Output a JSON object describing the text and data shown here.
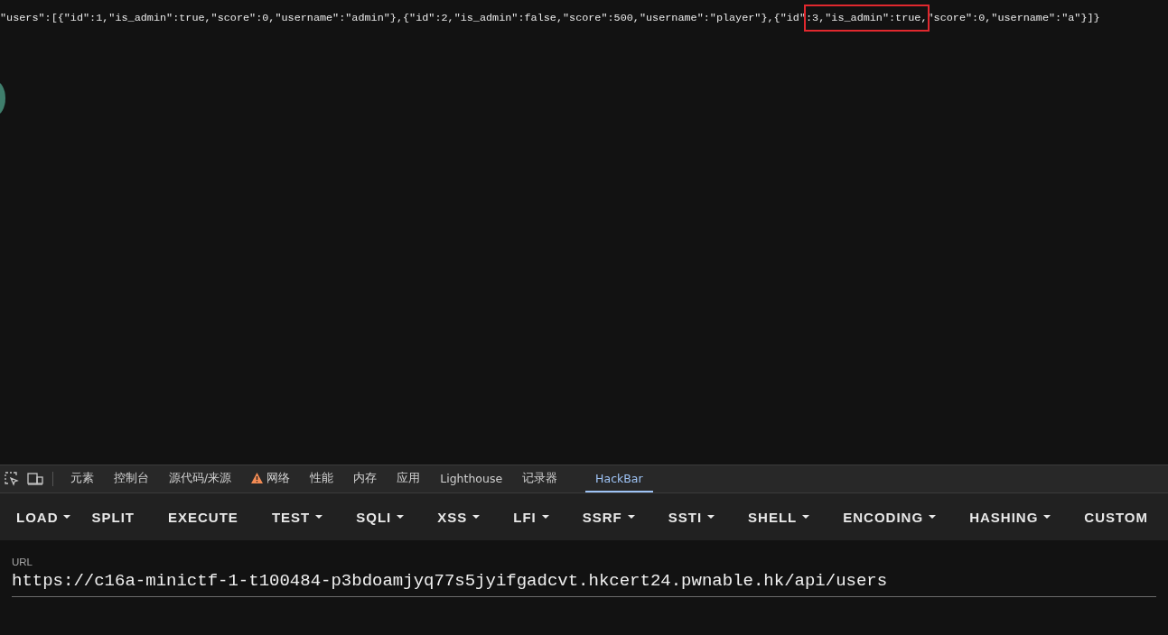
{
  "response": {
    "segments": [
      {
        "text": "\"users\":[{\"id\":1,\"is_admin\":true,\"score\":0,\"username\":\"admin\"},{\"id\":2,\"is_admin\":false,\"score\":500,\"username\":\"player\"},{\"id\"",
        "highlighted": false
      },
      {
        "text": ":3,\"is_admin\":true,",
        "highlighted": true
      },
      {
        "text": "\"score\":0,\"username\":\"a\"}]}",
        "highlighted": false
      }
    ]
  },
  "devtools": {
    "tabs": [
      {
        "label": "元素",
        "selected": false,
        "warning": false
      },
      {
        "label": "控制台",
        "selected": false,
        "warning": false
      },
      {
        "label": "源代码/来源",
        "selected": false,
        "warning": false
      },
      {
        "label": "网络",
        "selected": false,
        "warning": true
      },
      {
        "label": "性能",
        "selected": false,
        "warning": false
      },
      {
        "label": "内存",
        "selected": false,
        "warning": false
      },
      {
        "label": "应用",
        "selected": false,
        "warning": false
      },
      {
        "label": "Lighthouse",
        "selected": false,
        "warning": false
      },
      {
        "label": "记录器",
        "selected": false,
        "warning": false
      },
      {
        "label": "HackBar",
        "selected": true,
        "warning": false
      }
    ]
  },
  "hackbar": {
    "buttons": [
      {
        "label": "LOAD",
        "kind": "split"
      },
      {
        "label": "SPLIT",
        "kind": "plain"
      },
      {
        "label": "EXECUTE",
        "kind": "plain"
      },
      {
        "label": "TEST",
        "kind": "menu"
      },
      {
        "label": "SQLI",
        "kind": "menu"
      },
      {
        "label": "XSS",
        "kind": "menu"
      },
      {
        "label": "LFI",
        "kind": "menu"
      },
      {
        "label": "SSRF",
        "kind": "menu"
      },
      {
        "label": "SSTI",
        "kind": "menu"
      },
      {
        "label": "SHELL",
        "kind": "menu"
      },
      {
        "label": "ENCODING",
        "kind": "menu"
      },
      {
        "label": "HASHING",
        "kind": "menu"
      },
      {
        "label": "CUSTOM",
        "kind": "plain"
      }
    ],
    "url": {
      "label": "URL",
      "value": "https://c16a-minictf-1-t100484-p3bdoamjyq77s5jyifgadcvt.hkcert24.pwnable.hk/api/users"
    }
  }
}
